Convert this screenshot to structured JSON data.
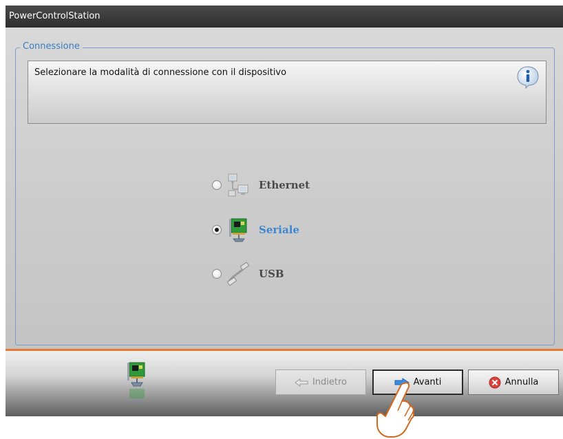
{
  "window": {
    "title": "PowerControlStation"
  },
  "connection_group": {
    "legend": "Connessione",
    "instruction": "Selezionare la modalità di connessione con il dispositivo",
    "info_icon": "info-icon"
  },
  "options": [
    {
      "label": "Ethernet",
      "icon": "ethernet-network-icon",
      "selected": false
    },
    {
      "label": "Seriale",
      "icon": "serial-card-icon",
      "selected": true
    },
    {
      "label": "USB",
      "icon": "usb-cable-icon",
      "selected": false
    }
  ],
  "footer": {
    "status_icon": "serial-card-icon",
    "back_label": "Indietro",
    "next_label": "Avanti",
    "cancel_label": "Annulla"
  },
  "colors": {
    "accent": "#3b86cf",
    "separator": "#e87a33",
    "legend": "#3a7cc0"
  }
}
